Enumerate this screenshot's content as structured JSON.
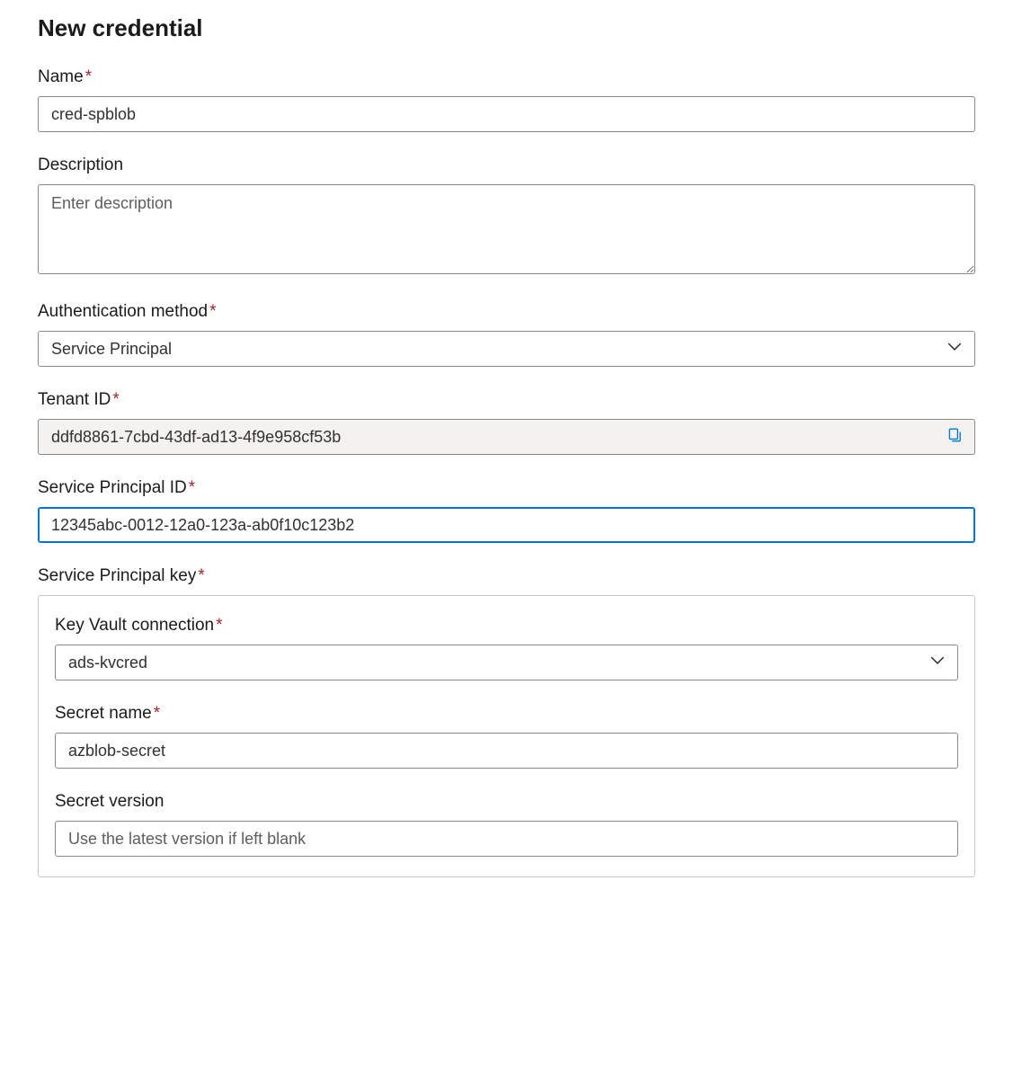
{
  "page": {
    "title": "New credential"
  },
  "fields": {
    "name": {
      "label": "Name",
      "value": "cred-spblob",
      "required": true
    },
    "description": {
      "label": "Description",
      "placeholder": "Enter description",
      "value": ""
    },
    "auth_method": {
      "label": "Authentication method",
      "value": "Service Principal",
      "required": true
    },
    "tenant_id": {
      "label": "Tenant ID",
      "value": "ddfd8861-7cbd-43df-ad13-4f9e958cf53b",
      "required": true
    },
    "sp_id": {
      "label": "Service Principal ID",
      "value": "12345abc-0012-12a0-123a-ab0f10c123b2",
      "required": true
    },
    "sp_key": {
      "label": "Service Principal key",
      "required": true,
      "kv_connection": {
        "label": "Key Vault connection",
        "value": "ads-kvcred",
        "required": true
      },
      "secret_name": {
        "label": "Secret name",
        "value": "azblob-secret",
        "required": true
      },
      "secret_version": {
        "label": "Secret version",
        "placeholder": "Use the latest version if left blank",
        "value": ""
      }
    }
  }
}
